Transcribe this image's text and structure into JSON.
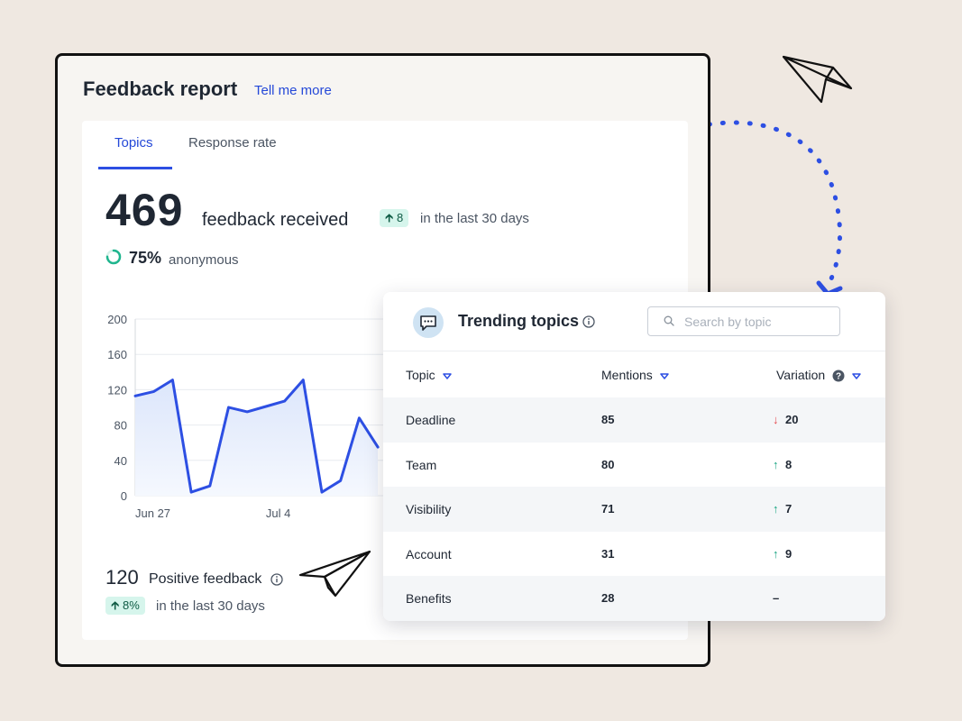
{
  "report": {
    "title": "Feedback report",
    "tell_more": "Tell me more",
    "tabs": [
      {
        "label": "Topics",
        "active": true
      },
      {
        "label": "Response rate",
        "active": false
      }
    ],
    "total": "469",
    "total_label": "feedback received",
    "delta": "8",
    "delta_note": "in the last 30 days",
    "anonymous_pct": "75%",
    "anonymous_label": "anonymous",
    "positive_count": "120",
    "positive_label": "Positive feedback",
    "positive_delta": "8%",
    "positive_note": "in the last 30 days"
  },
  "chart_data": {
    "type": "area",
    "x_tick_labels": [
      "Jun 27",
      "Jul 4"
    ],
    "y_ticks": [
      0,
      40,
      80,
      120,
      160,
      200
    ],
    "ylim": [
      0,
      200
    ],
    "values": [
      113,
      118,
      131,
      4,
      11,
      100,
      95,
      101,
      107,
      131,
      4,
      17,
      88,
      55
    ],
    "grid": true,
    "line_color": "#2d4fe3"
  },
  "trending": {
    "title": "Trending topics",
    "search_placeholder": "Search by topic",
    "columns": {
      "topic": "Topic",
      "mentions": "Mentions",
      "variation": "Variation"
    },
    "rows": [
      {
        "topic": "Deadline",
        "mentions": "85",
        "direction": "down",
        "variation": "20"
      },
      {
        "topic": "Team",
        "mentions": "80",
        "direction": "up",
        "variation": "8"
      },
      {
        "topic": "Visibility",
        "mentions": "71",
        "direction": "up",
        "variation": "7"
      },
      {
        "topic": "Account",
        "mentions": "31",
        "direction": "up",
        "variation": "9"
      },
      {
        "topic": "Benefits",
        "mentions": "28",
        "direction": "none",
        "variation": "–"
      }
    ]
  },
  "colors": {
    "accent": "#2d4fe3",
    "up": "#14a37f",
    "down": "#e5484d",
    "pill_bg": "#d6f5ec",
    "background": "#efe8e1"
  },
  "icons": [
    "paper-plane-icon",
    "chat-bubble-icon",
    "info-icon",
    "help-icon",
    "search-icon",
    "sort-icon",
    "arrow-up-icon",
    "arrow-down-icon"
  ]
}
